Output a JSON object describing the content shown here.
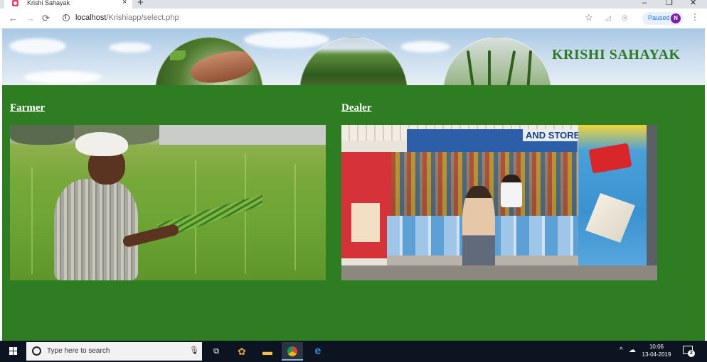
{
  "browser": {
    "tab_title": "Krishi Sahayak",
    "tab_close": "×",
    "new_tab": "+",
    "window_controls": {
      "minimize": "–",
      "restore": "❐",
      "close": "✕"
    },
    "nav": {
      "back": "←",
      "forward": "→",
      "reload": "⟳"
    },
    "url_host": "localhost",
    "url_path": "/Krishiapp/select.php",
    "bookmark_star": "☆",
    "toolbar_icons": [
      "cast-icon",
      "extension-icon"
    ],
    "profile": {
      "status": "Paused",
      "initial": "N",
      "color": "#7b1fa2"
    },
    "menu": "⋮"
  },
  "page": {
    "brand_title": "KRISHI SAHAYAK",
    "brand_color": "#2c7a22",
    "background_color": "#2e7d22",
    "options": [
      {
        "label": "Farmer",
        "image": "farmer-photo"
      },
      {
        "label": "Dealer",
        "image": "shop-photo",
        "image_text": "AND STORES"
      }
    ]
  },
  "taskbar": {
    "search_placeholder": "Type here to search",
    "apps": [
      "task-view",
      "app-1",
      "file-explorer",
      "chrome",
      "edge"
    ],
    "time": "10:06",
    "date": "13-04-2019",
    "notification_count": "2",
    "tray_chevron": "^"
  }
}
